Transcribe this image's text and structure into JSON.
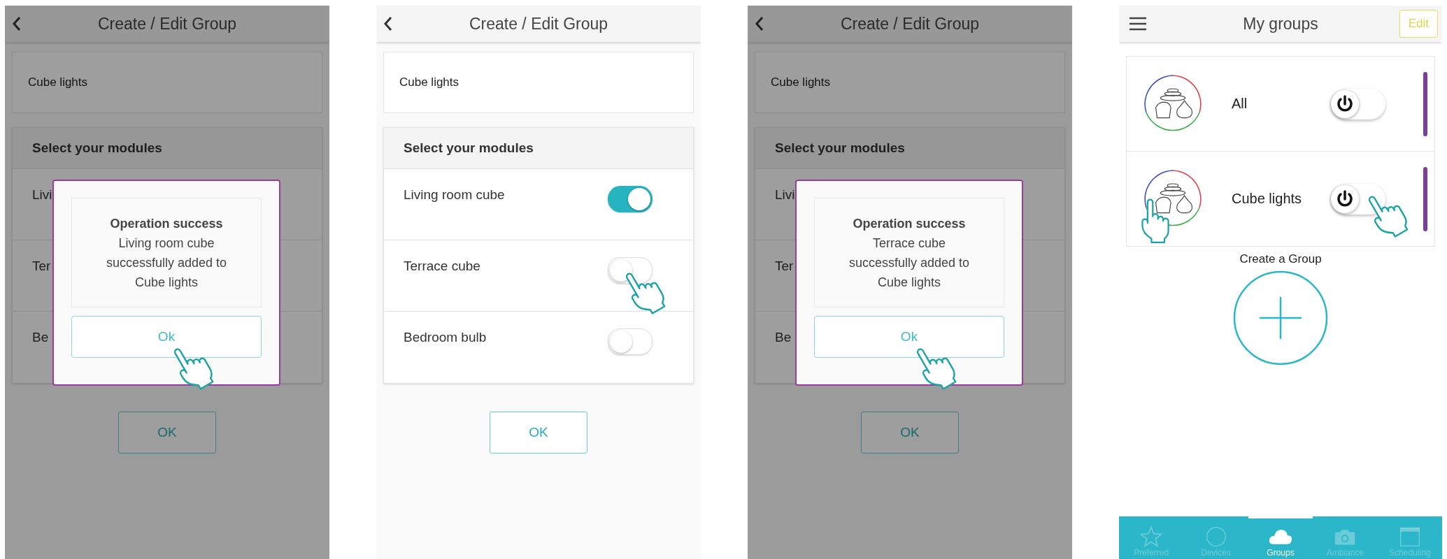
{
  "screens": [
    {
      "kind": "edit",
      "title": "Create / Edit Group",
      "group_name": "Cube lights",
      "modules_heading": "Select your modules",
      "modules": [
        {
          "name": "Livi"
        },
        {
          "name": "Ter"
        },
        {
          "name": "Be"
        }
      ],
      "ok_button": "OK",
      "dialog": {
        "title": "Operation success",
        "message": "Living room cube successfully added to Cube lights",
        "button": "Ok"
      }
    },
    {
      "kind": "edit",
      "title": "Create / Edit Group",
      "group_name": "Cube lights",
      "modules_heading": "Select your modules",
      "modules": [
        {
          "name": "Living room cube",
          "on": true
        },
        {
          "name": "Terrace cube",
          "on": false
        },
        {
          "name": "Bedroom bulb",
          "on": false
        }
      ],
      "ok_button": "OK"
    },
    {
      "kind": "edit",
      "title": "Create / Edit Group",
      "group_name": "Cube lights",
      "modules_heading": "Select your modules",
      "modules": [
        {
          "name": "Livi"
        },
        {
          "name": "Ter"
        },
        {
          "name": "Be"
        }
      ],
      "ok_button": "OK",
      "dialog": {
        "title": "Operation success",
        "message": "Terrace cube successfully added to Cube lights",
        "button": "Ok"
      }
    },
    {
      "kind": "groups",
      "title": "My groups",
      "edit_button": "Edit",
      "groups": [
        {
          "name": "All",
          "on": false
        },
        {
          "name": "Cube lights",
          "on": false
        }
      ],
      "create_label": "Create a Group",
      "tabs": [
        {
          "label": "Preferred",
          "selected": false
        },
        {
          "label": "Devices",
          "selected": false
        },
        {
          "label": "Groups",
          "selected": true
        },
        {
          "label": "Ambiance",
          "selected": false
        },
        {
          "label": "Scheduling",
          "selected": false
        }
      ]
    }
  ]
}
